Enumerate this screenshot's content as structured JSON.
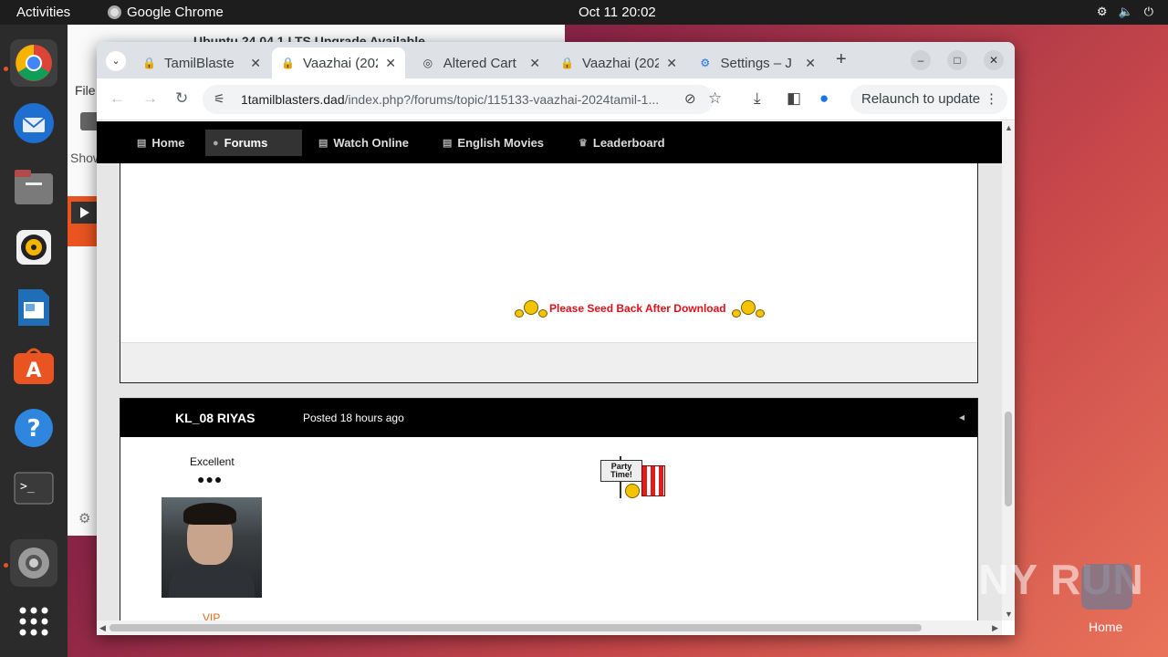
{
  "topbar": {
    "activities": "Activities",
    "app_name": "Google Chrome",
    "clock": "Oct 11  20:02"
  },
  "dock": {
    "items": [
      "chrome-icon",
      "thunderbird-icon",
      "files-icon",
      "rhythmbox-icon",
      "writer-icon",
      "app-center-icon",
      "help-icon",
      "terminal-icon",
      "settings-icon",
      "show-apps-icon"
    ]
  },
  "background_window": {
    "title": "Ubuntu 24.04.1 LTS Upgrade Available",
    "menu_file": "File",
    "show_label": "Show"
  },
  "browser": {
    "tabs": [
      {
        "title": "TamilBlaste",
        "active": false
      },
      {
        "title": "Vaazhai (202",
        "active": true
      },
      {
        "title": "Altered Cart",
        "active": false
      },
      {
        "title": "Vaazhai (202",
        "active": false
      },
      {
        "title": "Settings – J",
        "active": false
      }
    ],
    "new_tab": "+",
    "url_domain": "1tamilblasters.dad",
    "url_path": "/index.php?/forums/topic/115133-vaazhai-2024tamil-1...",
    "relaunch": "Relaunch to update"
  },
  "site": {
    "nav": [
      {
        "label": "Home",
        "active": false
      },
      {
        "label": "Forums",
        "active": true
      },
      {
        "label": "Watch Online",
        "active": false
      },
      {
        "label": "English Movies",
        "active": false
      },
      {
        "label": "Leaderboard",
        "active": false
      }
    ],
    "seed_text": "Please Seed Back After Download",
    "post": {
      "author": "KL_08 RIYAS",
      "posted_prefix": "Posted",
      "posted_time": "18 hours ago",
      "rank": "Excellent",
      "pips": "●●●",
      "member_group": "VIP",
      "party_sign": "Party Time!"
    }
  },
  "watermark": "ANY RUN",
  "desktop": {
    "home_label": "Home"
  },
  "colors": {
    "accent": "#e95420",
    "seed_red": "#e0101a",
    "vip_orange": "#e06a1a"
  }
}
